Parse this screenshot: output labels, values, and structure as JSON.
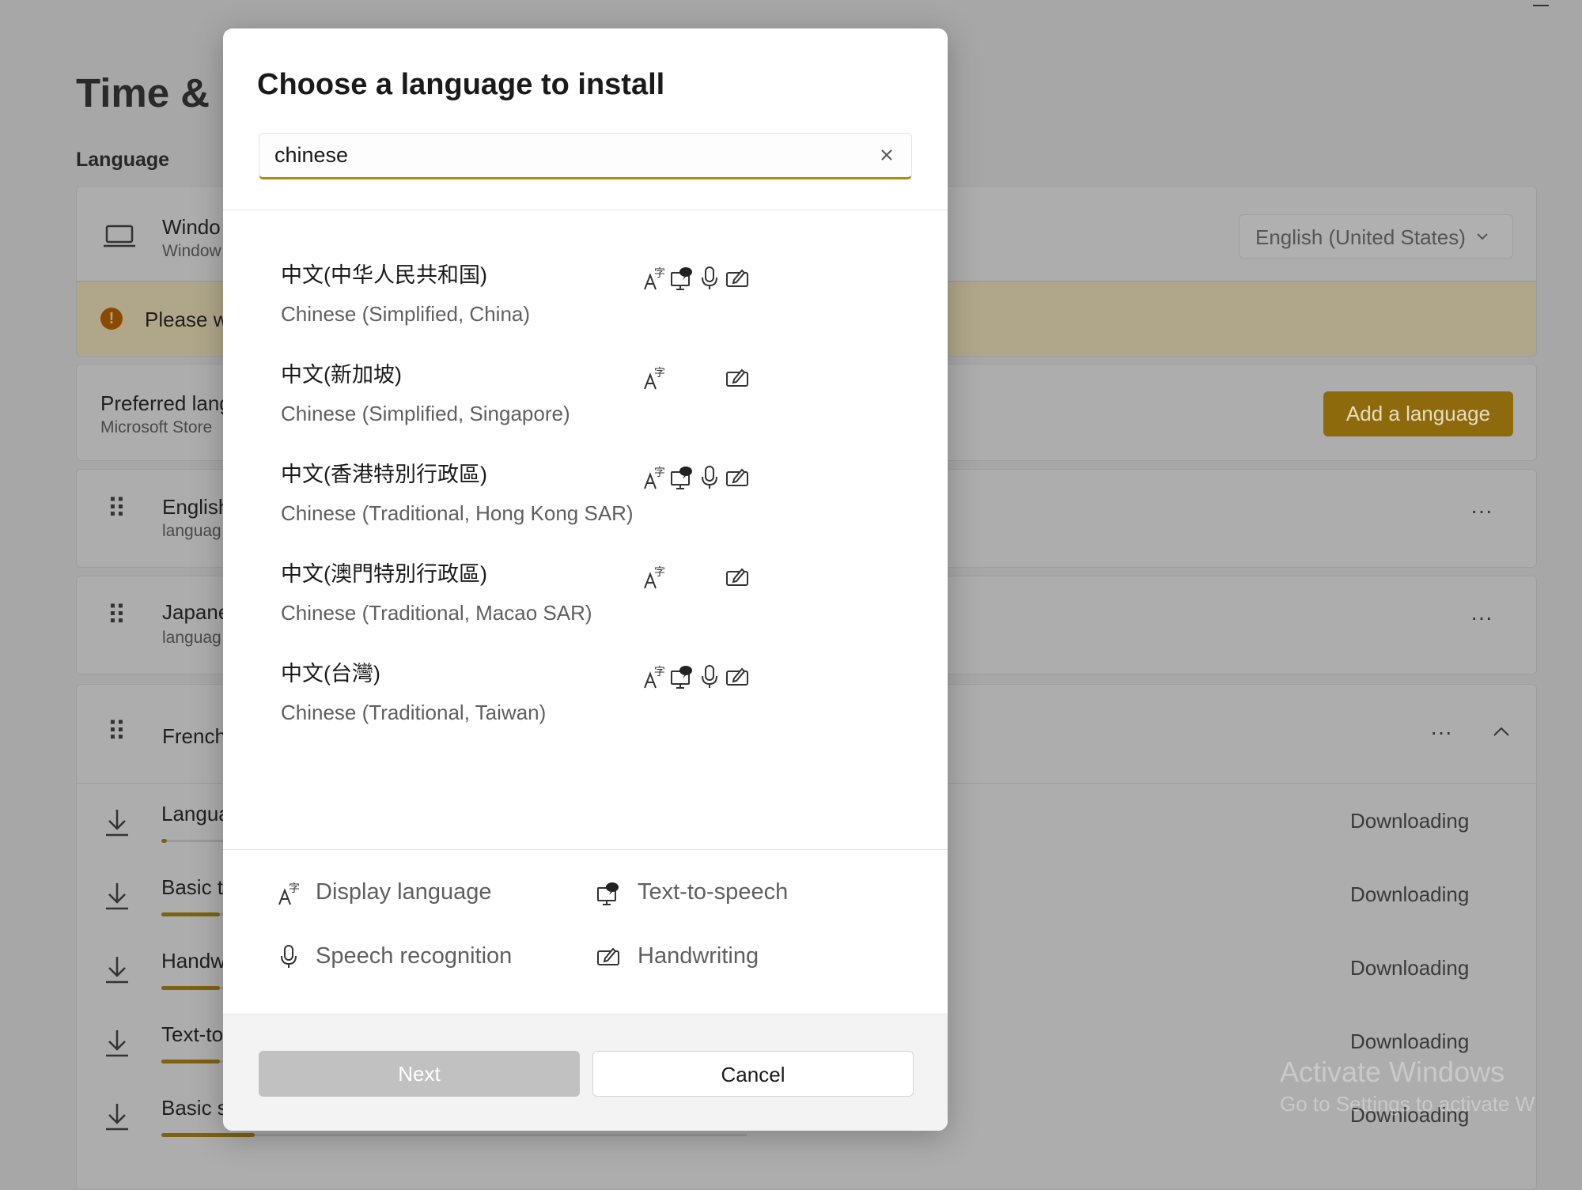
{
  "background": {
    "page_title": "Time & l",
    "section_label": "Language",
    "window_display": {
      "title": "Windo",
      "subtitle": "Window",
      "dropdown_value": "English (United States)"
    },
    "warning": {
      "text": "Please w"
    },
    "preferred": {
      "title": "Preferred lang",
      "subtitle": "Microsoft Store",
      "add_button": "Add a language"
    },
    "languages": [
      {
        "name": "English",
        "sub": "languag"
      },
      {
        "name": "Japane",
        "sub": "languag"
      },
      {
        "name": "French",
        "sub": ""
      }
    ],
    "french_features": [
      {
        "label": "Langua",
        "status": "Downloading",
        "progress": 0.01
      },
      {
        "label": "Basic t",
        "status": "Downloading",
        "progress": 0.1
      },
      {
        "label": "Handw",
        "status": "Downloading",
        "progress": 0.1
      },
      {
        "label": "Text-to",
        "status": "Downloading",
        "progress": 0.1
      },
      {
        "label": "Basic s",
        "status": "Downloading",
        "progress": 0.16
      }
    ],
    "watermark": {
      "line1": "Activate Windows",
      "line2": "Go to Settings to activate W"
    },
    "accent": "#b08a0a"
  },
  "dialog": {
    "title": "Choose a language to install",
    "search_value": "chinese",
    "results": [
      {
        "native": "中文(中华人民共和国)",
        "english": "Chinese (Simplified, China)",
        "features": [
          "display",
          "tts",
          "speech",
          "handwriting"
        ]
      },
      {
        "native": "中文(新加坡)",
        "english": "Chinese (Simplified, Singapore)",
        "features": [
          "display",
          "handwriting"
        ]
      },
      {
        "native": "中文(香港特別行政區)",
        "english": "Chinese (Traditional, Hong Kong SAR)",
        "features": [
          "display",
          "tts",
          "speech",
          "handwriting"
        ]
      },
      {
        "native": "中文(澳門特別行政區)",
        "english": "Chinese (Traditional, Macao SAR)",
        "features": [
          "display",
          "handwriting"
        ]
      },
      {
        "native": "中文(台灣)",
        "english": "Chinese (Traditional, Taiwan)",
        "features": [
          "display",
          "tts",
          "speech",
          "handwriting"
        ]
      }
    ],
    "legend": {
      "display": "Display language",
      "tts": "Text-to-speech",
      "speech": "Speech recognition",
      "handwriting": "Handwriting"
    },
    "next_label": "Next",
    "cancel_label": "Cancel"
  }
}
